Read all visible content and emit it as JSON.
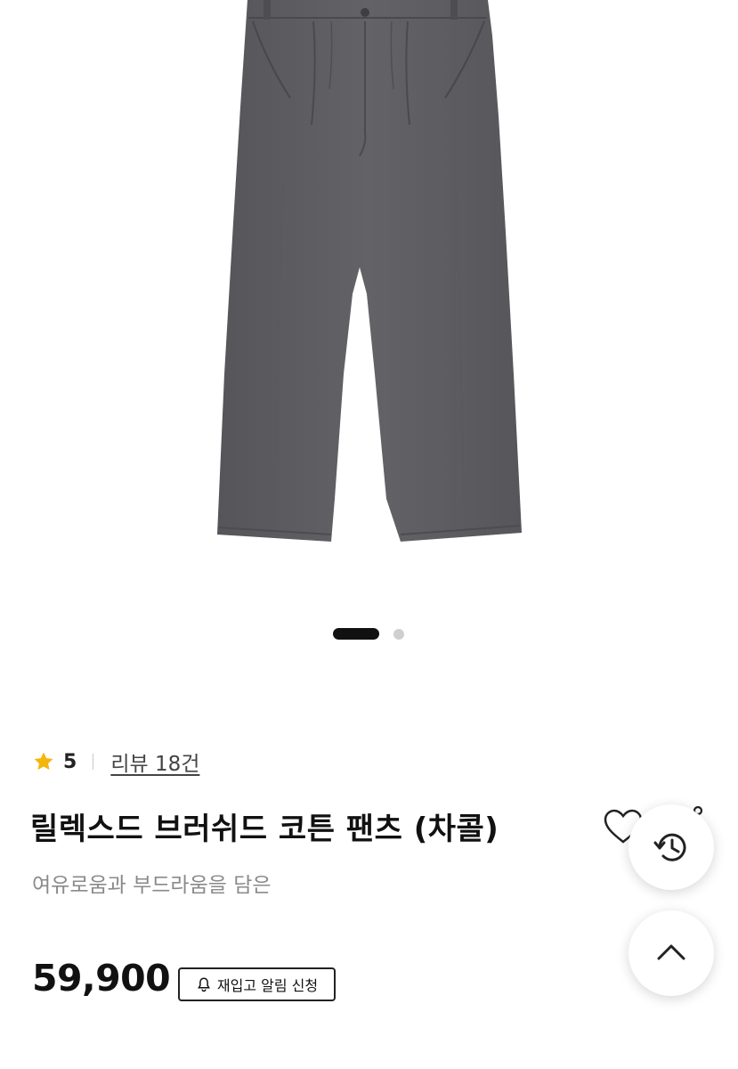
{
  "product": {
    "image_alt": "Charcoal pleated wide cotton pants",
    "rating": "5",
    "review_link": "리뷰 18건",
    "title": "릴렉스드 브러쉬드 코튼 팬츠 (차콜)",
    "subtitle": "여유로움과 부드라움을 담은",
    "price": "59,900",
    "restock_label": "재입고 알림 신청"
  },
  "pager": {
    "total": 2,
    "active": 1
  },
  "colors": {
    "accent_star": "#f5b50a",
    "pants": "#5d5d60",
    "text_primary": "#111111",
    "text_muted": "#8a8a8a"
  },
  "icons": {
    "star": "star-icon",
    "wishlist": "heart-outline-icon",
    "share": "share-icon",
    "bell": "bell-icon",
    "history": "history-icon",
    "scroll_top": "chevron-up-icon"
  }
}
